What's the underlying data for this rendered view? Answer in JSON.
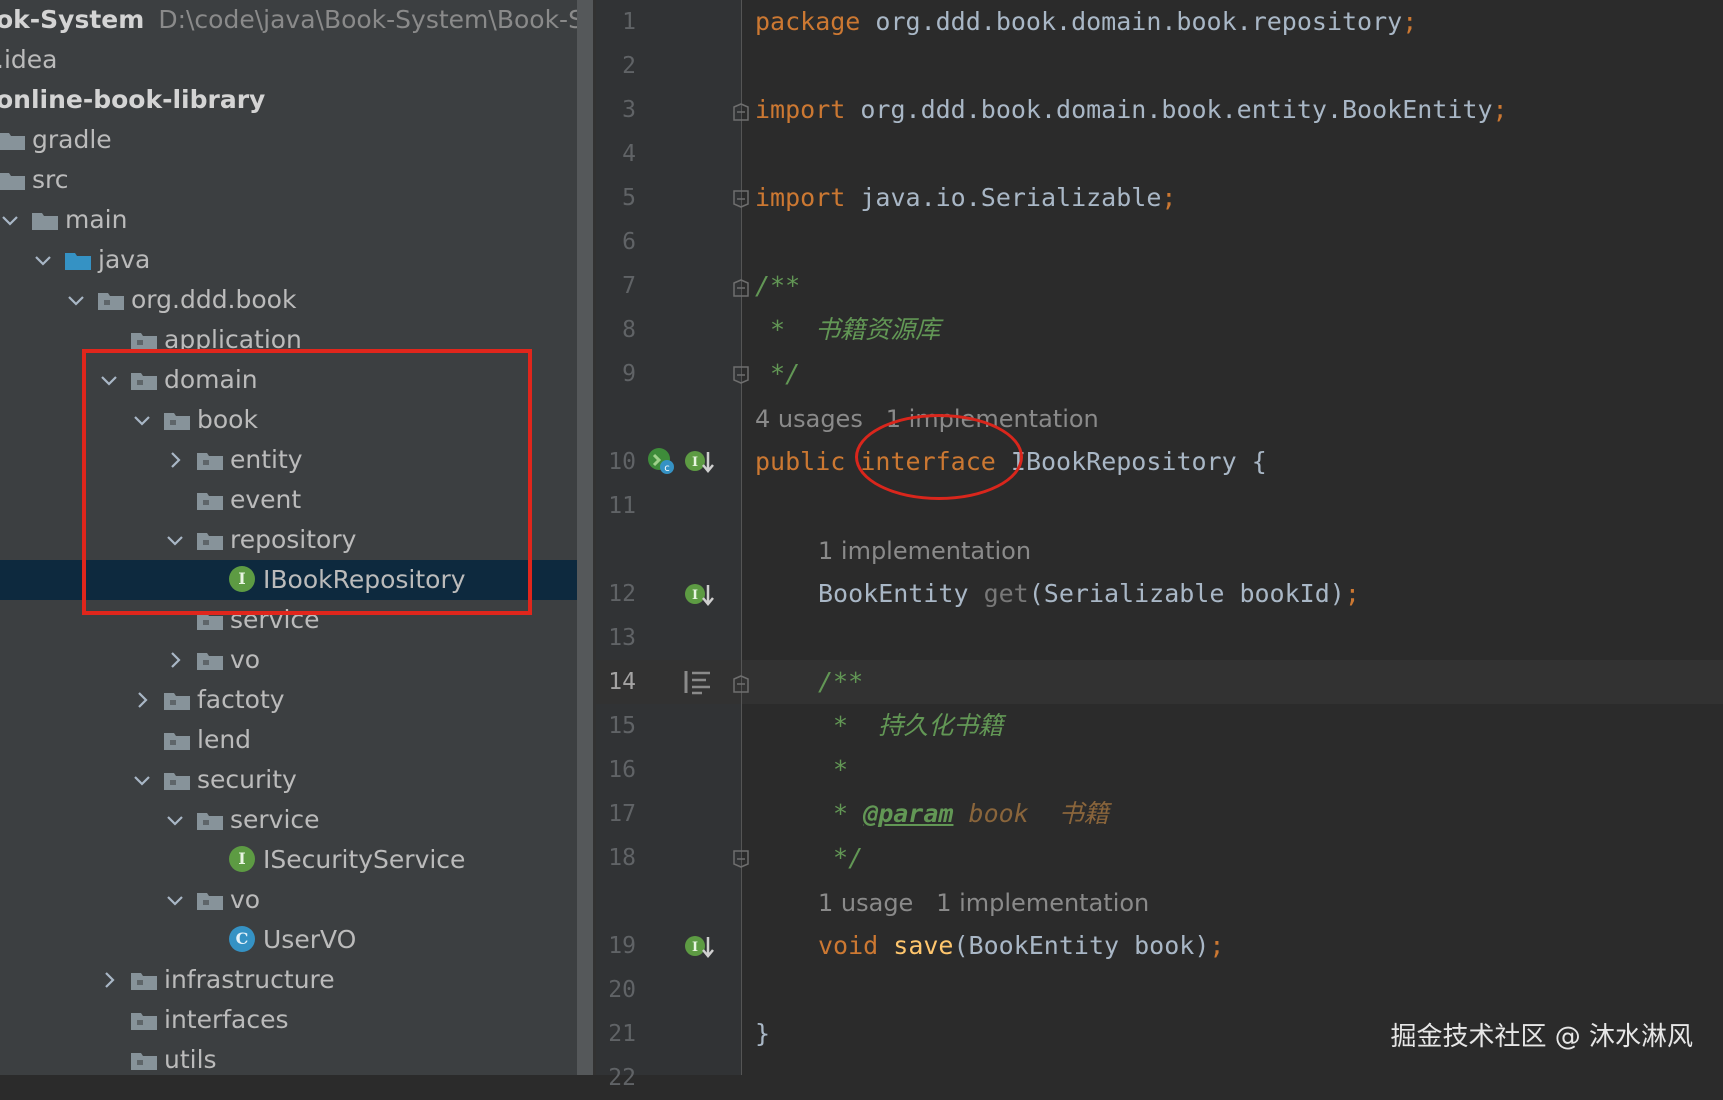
{
  "project": {
    "name": "ok-System",
    "path": "D:\\code\\java\\Book-System\\Book-System"
  },
  "tree": {
    "nodes": [
      {
        "label": ".idea",
        "type": "plain",
        "indent": 0
      },
      {
        "label": "online-book-library",
        "type": "module",
        "indent": 0
      },
      {
        "label": "gradle",
        "type": "folder",
        "indent": 0
      },
      {
        "label": "src",
        "type": "folder",
        "indent": 0
      },
      {
        "label": "main",
        "type": "folder",
        "indent": 1,
        "arrow": "down"
      },
      {
        "label": "java",
        "type": "source-folder",
        "indent": 2,
        "arrow": "down"
      },
      {
        "label": "org.ddd.book",
        "type": "package",
        "indent": 3,
        "arrow": "down"
      },
      {
        "label": "application",
        "type": "package",
        "indent": 4
      },
      {
        "label": "domain",
        "type": "package",
        "indent": 4,
        "arrow": "down"
      },
      {
        "label": "book",
        "type": "package",
        "indent": 5,
        "arrow": "down"
      },
      {
        "label": "entity",
        "type": "package",
        "indent": 6,
        "arrow": "right"
      },
      {
        "label": "event",
        "type": "package",
        "indent": 6
      },
      {
        "label": "repository",
        "type": "package",
        "indent": 6,
        "arrow": "down"
      },
      {
        "label": "IBookRepository",
        "type": "interface",
        "indent": 7,
        "selected": true
      },
      {
        "label": "service",
        "type": "package",
        "indent": 6
      },
      {
        "label": "vo",
        "type": "package",
        "indent": 6,
        "arrow": "right"
      },
      {
        "label": "factoty",
        "type": "package",
        "indent": 5,
        "arrow": "right"
      },
      {
        "label": "lend",
        "type": "package",
        "indent": 5
      },
      {
        "label": "security",
        "type": "package",
        "indent": 5,
        "arrow": "down"
      },
      {
        "label": "service",
        "type": "package",
        "indent": 6,
        "arrow": "down"
      },
      {
        "label": "ISecurityService",
        "type": "interface",
        "indent": 7
      },
      {
        "label": "vo",
        "type": "package",
        "indent": 6,
        "arrow": "down"
      },
      {
        "label": "UserVO",
        "type": "class",
        "indent": 7
      },
      {
        "label": "infrastructure",
        "type": "package",
        "indent": 4,
        "arrow": "right"
      },
      {
        "label": "interfaces",
        "type": "package",
        "indent": 4
      },
      {
        "label": "utils",
        "type": "package",
        "indent": 4
      }
    ]
  },
  "editor": {
    "line_numbers": [
      "1",
      "2",
      "3",
      "4",
      "5",
      "6",
      "7",
      "8",
      "9",
      "10",
      "11",
      "12",
      "13",
      "14",
      "15",
      "16",
      "17",
      "18",
      "19",
      "20",
      "21",
      "22"
    ],
    "current_line": "14",
    "code": {
      "l1": {
        "kw": "package",
        "text": " org.ddd.book.domain.book.repository",
        "semi": ";"
      },
      "l3": {
        "kw": "import",
        "text": " org.ddd.book.domain.book.entity.BookEntity",
        "semi": ";"
      },
      "l5": {
        "kw": "import",
        "text": " java.io.Serializable",
        "semi": ";"
      },
      "l7": "/**",
      "l8": " *  书籍资源库",
      "l9": " */",
      "hint10": "4 usages   1 implementation",
      "l10": {
        "kw1": "public",
        "kw2": "interface",
        "text": " IBookRepository {"
      },
      "hint12": "1 implementation",
      "l12": {
        "type": "BookEntity",
        "method": "get",
        "params": "(Serializable bookId)",
        "semi": ";"
      },
      "l14": "/**",
      "l15": " *  持久化书籍",
      "l16": " *",
      "l17": {
        "star": " * ",
        "tag": "@param",
        "name": "book",
        "desc": "书籍"
      },
      "l18": " */",
      "hint19": "1 usage   1 implementation",
      "l19": {
        "kw": "void",
        "method": "save",
        "params": "(BookEntity book)",
        "semi": ";"
      },
      "l21": "}"
    }
  },
  "watermark": "掘金技术社区 @ 沐水淋风",
  "colors": {
    "keyword": "#cc7832",
    "comment": "#629755",
    "method": "#ffc66d",
    "annotation_red": "#e0261c",
    "selection": "#0d293e"
  }
}
